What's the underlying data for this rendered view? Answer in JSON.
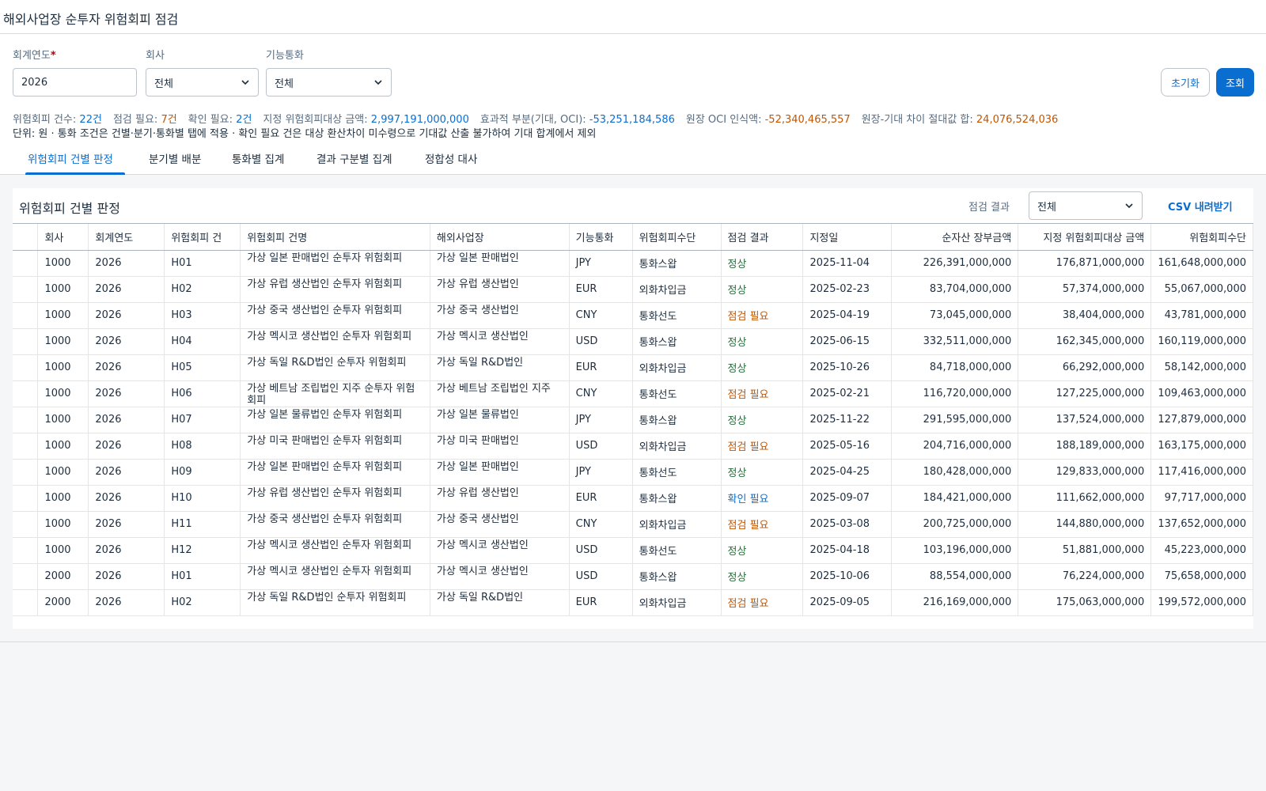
{
  "page": {
    "title": "해외사업장 순투자 위험회피 점검"
  },
  "filters": {
    "fiscal_year_label": "회계연도",
    "required_mark": "*",
    "fiscal_year_value": "2026",
    "company_label": "회사",
    "company_value": "전체",
    "currency_label": "기능통화",
    "currency_value": "전체",
    "reset_label": "초기화",
    "search_label": "조회"
  },
  "summary": [
    {
      "label": "위험회피 건수:",
      "value": "22건",
      "tone": "blue"
    },
    {
      "label": "점검 필요:",
      "value": "7건",
      "tone": "orange"
    },
    {
      "label": "확인 필요:",
      "value": "2건",
      "tone": "blue"
    },
    {
      "label": "지정 위험회피대상 금액:",
      "value": "2,997,191,000,000",
      "tone": "blue"
    },
    {
      "label": "효과적 부분(기대, OCI):",
      "value": "-53,251,184,586",
      "tone": "blue"
    },
    {
      "label": "원장 OCI 인식액:",
      "value": "-52,340,465,557",
      "tone": "orange"
    },
    {
      "label": "원장-기대 차이 절대값 합:",
      "value": "24,076,524,036",
      "tone": "orange"
    }
  ],
  "unit_note": "단위: 원 · 통화 조건은 건별·분기·통화별 탭에 적용 · 확인 필요 건은 대상 환산차이 미수령으로 기대값 산출 불가하여 기대 합계에서 제외",
  "tabs": [
    {
      "label": "위험회피 건별 판정",
      "active": true
    },
    {
      "label": "분기별 배분",
      "active": false
    },
    {
      "label": "통화별 집계",
      "active": false
    },
    {
      "label": "결과 구분별 집계",
      "active": false
    },
    {
      "label": "정합성 대사",
      "active": false
    }
  ],
  "panel": {
    "title": "위험회피 건별 판정",
    "filter_label": "점검 결과",
    "filter_value": "전체",
    "csv_label": "CSV 내려받기"
  },
  "table": {
    "columns": [
      "",
      "회사",
      "회계연도",
      "위험회피 건",
      "위험회피 건명",
      "해외사업장",
      "기능통화",
      "위험회피수단",
      "점검 결과",
      "지정일",
      "순자산 장부금액",
      "지정 위험회피대상 금액",
      "위험회피수단"
    ],
    "rows": [
      [
        "1000",
        "2026",
        "H01",
        "가상 일본 판매법인 순투자 위험회피",
        "가상 일본 판매법인",
        "JPY",
        "통화스왑",
        "정상",
        "2025-11-04",
        "226,391,000,000",
        "176,871,000,000",
        "161,648,000,000"
      ],
      [
        "1000",
        "2026",
        "H02",
        "가상 유럽 생산법인 순투자 위험회피",
        "가상 유럽 생산법인",
        "EUR",
        "외화차입금",
        "정상",
        "2025-02-23",
        "83,704,000,000",
        "57,374,000,000",
        "55,067,000,000"
      ],
      [
        "1000",
        "2026",
        "H03",
        "가상 중국 생산법인 순투자 위험회피",
        "가상 중국 생산법인",
        "CNY",
        "통화선도",
        "점검 필요",
        "2025-04-19",
        "73,045,000,000",
        "38,404,000,000",
        "43,781,000,000"
      ],
      [
        "1000",
        "2026",
        "H04",
        "가상 멕시코 생산법인 순투자 위험회피",
        "가상 멕시코 생산법인",
        "USD",
        "통화스왑",
        "정상",
        "2025-06-15",
        "332,511,000,000",
        "162,345,000,000",
        "160,119,000,000"
      ],
      [
        "1000",
        "2026",
        "H05",
        "가상 독일 R&D법인 순투자 위험회피",
        "가상 독일 R&D법인",
        "EUR",
        "외화차입금",
        "정상",
        "2025-10-26",
        "84,718,000,000",
        "66,292,000,000",
        "58,142,000,000"
      ],
      [
        "1000",
        "2026",
        "H06",
        "가상 베트남 조립법인 지주 순투자 위험회피",
        "가상 베트남 조립법인 지주",
        "CNY",
        "통화선도",
        "점검 필요",
        "2025-02-21",
        "116,720,000,000",
        "127,225,000,000",
        "109,463,000,000"
      ],
      [
        "1000",
        "2026",
        "H07",
        "가상 일본 물류법인 순투자 위험회피",
        "가상 일본 물류법인",
        "JPY",
        "통화스왑",
        "정상",
        "2025-11-22",
        "291,595,000,000",
        "137,524,000,000",
        "127,879,000,000"
      ],
      [
        "1000",
        "2026",
        "H08",
        "가상 미국 판매법인 순투자 위험회피",
        "가상 미국 판매법인",
        "USD",
        "외화차입금",
        "점검 필요",
        "2025-05-16",
        "204,716,000,000",
        "188,189,000,000",
        "163,175,000,000"
      ],
      [
        "1000",
        "2026",
        "H09",
        "가상 일본 판매법인 순투자 위험회피",
        "가상 일본 판매법인",
        "JPY",
        "통화선도",
        "정상",
        "2025-04-25",
        "180,428,000,000",
        "129,833,000,000",
        "117,416,000,000"
      ],
      [
        "1000",
        "2026",
        "H10",
        "가상 유럽 생산법인 순투자 위험회피",
        "가상 유럽 생산법인",
        "EUR",
        "통화스왑",
        "확인 필요",
        "2025-09-07",
        "184,421,000,000",
        "111,662,000,000",
        "97,717,000,000"
      ],
      [
        "1000",
        "2026",
        "H11",
        "가상 중국 생산법인 순투자 위험회피",
        "가상 중국 생산법인",
        "CNY",
        "외화차입금",
        "점검 필요",
        "2025-03-08",
        "200,725,000,000",
        "144,880,000,000",
        "137,652,000,000"
      ],
      [
        "1000",
        "2026",
        "H12",
        "가상 멕시코 생산법인 순투자 위험회피",
        "가상 멕시코 생산법인",
        "USD",
        "통화선도",
        "정상",
        "2025-04-18",
        "103,196,000,000",
        "51,881,000,000",
        "45,223,000,000"
      ],
      [
        "2000",
        "2026",
        "H01",
        "가상 멕시코 생산법인 순투자 위험회피",
        "가상 멕시코 생산법인",
        "USD",
        "통화스왑",
        "정상",
        "2025-10-06",
        "88,554,000,000",
        "76,224,000,000",
        "75,658,000,000"
      ],
      [
        "2000",
        "2026",
        "H02",
        "가상 독일 R&D법인 순투자 위험회피",
        "가상 독일 R&D법인",
        "EUR",
        "외화차입금",
        "점검 필요",
        "2025-09-05",
        "216,169,000,000",
        "175,063,000,000",
        "199,572,000,000"
      ]
    ]
  },
  "colors": {
    "accent": "#0a6ed1",
    "ok": "#256f3a",
    "warn": "#c35500"
  }
}
